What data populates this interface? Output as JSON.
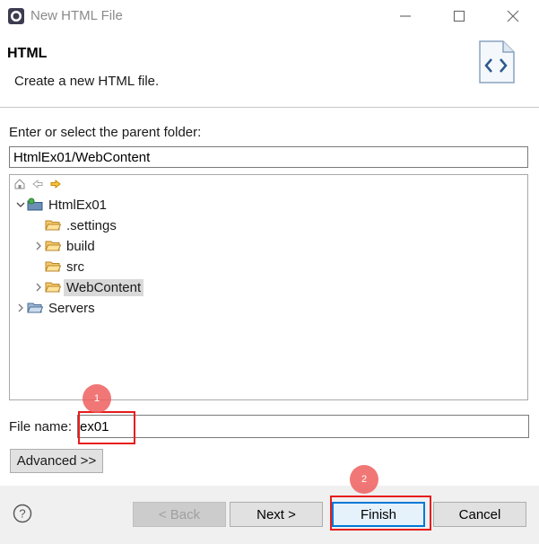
{
  "window": {
    "title": "New HTML File",
    "controls": {
      "minimize": "—",
      "maximize": "☐",
      "close": "✕"
    }
  },
  "banner": {
    "title": "HTML",
    "description": "Create a new HTML file."
  },
  "parent_folder": {
    "label": "Enter or select the parent folder:",
    "value": "HtmlEx01/WebContent"
  },
  "tree": {
    "toolbar_icons": [
      "home-icon",
      "back-arrow-icon",
      "forward-arrow-icon"
    ],
    "items": [
      {
        "label": "HtmlEx01",
        "icon": "project-icon",
        "expanded": true
      },
      {
        "label": ".settings",
        "icon": "folder-icon"
      },
      {
        "label": "build",
        "icon": "folder-icon",
        "expandable": true
      },
      {
        "label": "src",
        "icon": "folder-icon"
      },
      {
        "label": "WebContent",
        "icon": "folder-icon",
        "expandable": true,
        "selected": true
      },
      {
        "label": "Servers",
        "icon": "folder-icon",
        "expandable": true
      }
    ]
  },
  "file_name": {
    "label": "File name:",
    "value": "ex01"
  },
  "advanced_label": "Advanced >>",
  "footer": {
    "help": "?",
    "back": "< Back",
    "next": "Next >",
    "finish": "Finish",
    "cancel": "Cancel"
  },
  "annotations": {
    "badge_1": "1",
    "badge_2": "2"
  },
  "colors": {
    "highlight": "#e81c1c",
    "badge": "#ef5f5f",
    "default_button_border": "#0078d7",
    "folder": "#e8b34a"
  }
}
